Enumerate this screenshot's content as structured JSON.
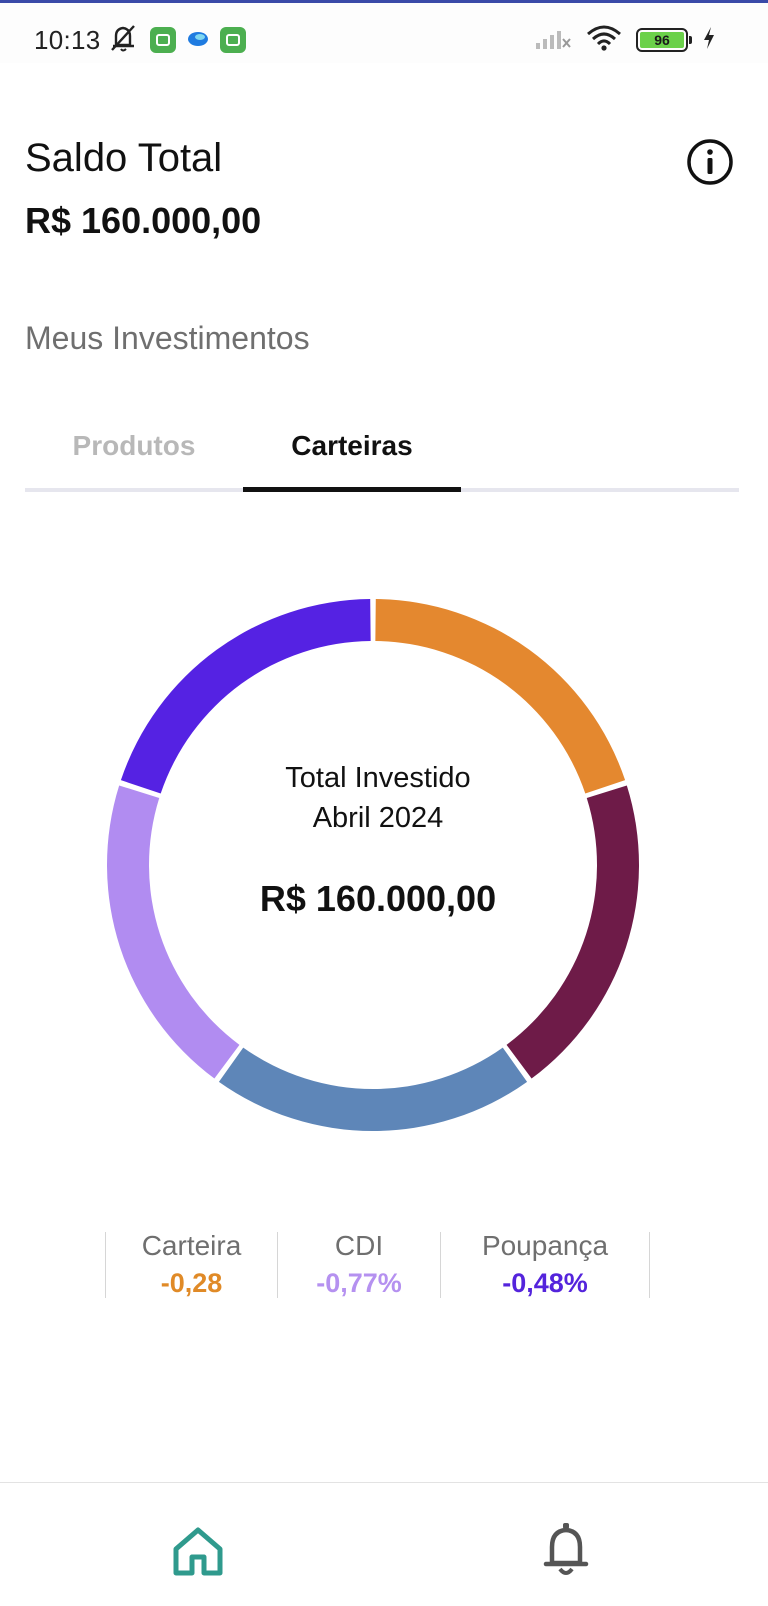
{
  "status_bar": {
    "time": "10:13",
    "battery_level": "96",
    "icons": [
      "muted-bell-icon",
      "app-icon",
      "edge-browser-icon",
      "app-icon",
      "signal-icon",
      "wifi-icon",
      "battery-icon",
      "charging-icon"
    ]
  },
  "header": {
    "title": "Saldo Total",
    "balance": "R$ 160.000,00",
    "info_icon": "info-icon"
  },
  "section": {
    "title": "Meus Investimentos"
  },
  "tabs": [
    {
      "label": "Produtos",
      "active": false
    },
    {
      "label": "Carteiras",
      "active": true
    }
  ],
  "donut": {
    "line1": "Total Investido",
    "line2": "Abril 2024",
    "value": "R$ 160.000,00",
    "segment_colors": [
      "#e4882f",
      "#6e1b48",
      "#5e86b8",
      "#b18cf1",
      "#5522e3"
    ],
    "segment_shares": [
      0.2,
      0.2,
      0.2,
      0.2,
      0.2
    ]
  },
  "stats": [
    {
      "label": "Carteira",
      "value": "-0,28",
      "color": "#e08a27"
    },
    {
      "label": "CDI",
      "value": "-0,77%",
      "color": "#b591f0"
    },
    {
      "label": "Poupança",
      "value": "-0,48%",
      "color": "#5424dc"
    }
  ],
  "bottom_nav": {
    "items": [
      {
        "icon": "home-icon",
        "active": true,
        "color": "#2f9a8d"
      },
      {
        "icon": "bell-icon",
        "active": false,
        "color": "#555555"
      }
    ]
  }
}
